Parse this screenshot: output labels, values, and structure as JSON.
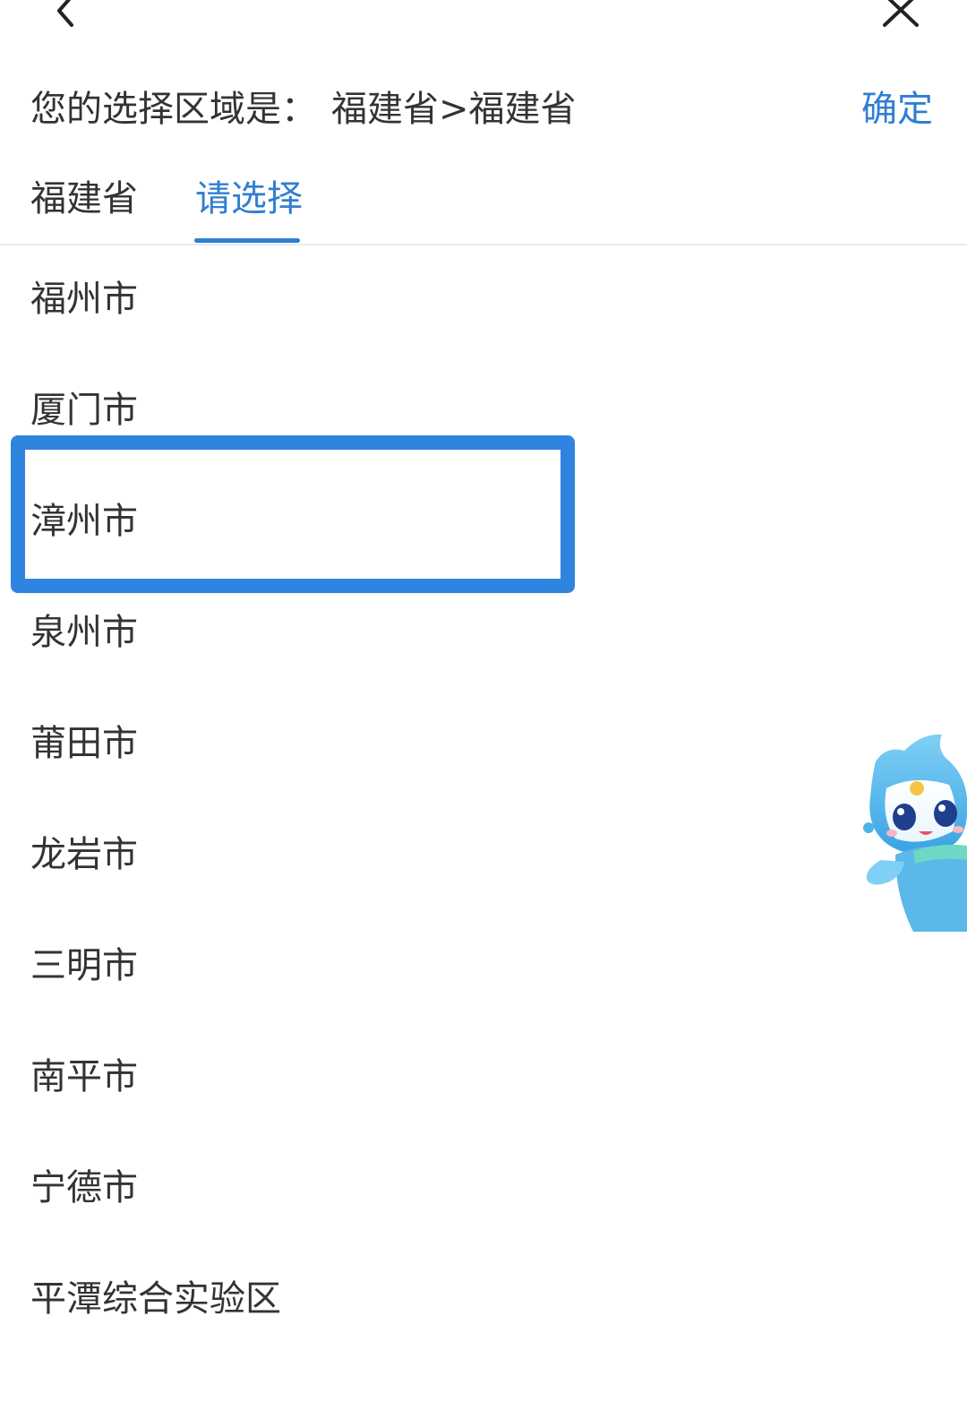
{
  "icons": {
    "back": "chevron-left-icon",
    "close": "close-icon",
    "mascot": "mascot-robot-icon"
  },
  "colors": {
    "accent": "#2f7fd1",
    "highlight_border": "#2f84df",
    "text": "#333333",
    "divider": "#ececec"
  },
  "header": {
    "selection_label": "您的选择区域是：",
    "selection_value": "福建省>福建省",
    "confirm_label": "确定"
  },
  "tabs": [
    {
      "label": "福建省",
      "active": false
    },
    {
      "label": "请选择",
      "active": true
    }
  ],
  "cities": [
    {
      "label": "福州市"
    },
    {
      "label": "厦门市"
    },
    {
      "label": "漳州市",
      "highlighted": true
    },
    {
      "label": "泉州市"
    },
    {
      "label": "莆田市"
    },
    {
      "label": "龙岩市"
    },
    {
      "label": "三明市"
    },
    {
      "label": "南平市"
    },
    {
      "label": "宁德市"
    },
    {
      "label": "平潭综合实验区"
    }
  ]
}
